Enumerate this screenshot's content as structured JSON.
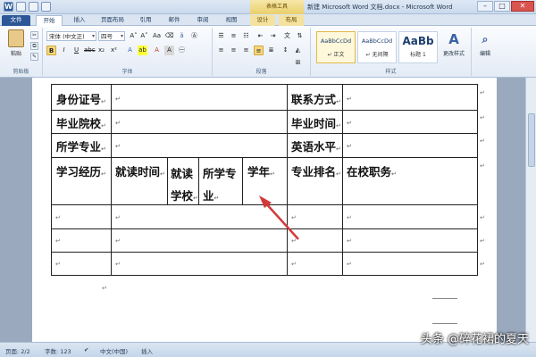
{
  "window": {
    "title": "新建 Microsoft Word 文档.docx - Microsoft Word",
    "context_tab_group": "表格工具"
  },
  "tabs": [
    {
      "label": "文件"
    },
    {
      "label": "开始"
    },
    {
      "label": "插入"
    },
    {
      "label": "页面布局"
    },
    {
      "label": "引用"
    },
    {
      "label": "邮件"
    },
    {
      "label": "审阅"
    },
    {
      "label": "视图"
    },
    {
      "label": "设计"
    },
    {
      "label": "布局"
    }
  ],
  "ribbon": {
    "clipboard": {
      "paste_label": "粘贴",
      "group_label": "剪贴板"
    },
    "font": {
      "font_name": "宋体 (中文正)",
      "font_size": "四号",
      "group_label": "字体"
    },
    "paragraph": {
      "group_label": "段落"
    },
    "styles": {
      "group_label": "样式",
      "items": [
        {
          "sample": "AaBbCcDd",
          "name": "↵ 正文"
        },
        {
          "sample": "AaBbCcDd",
          "name": "↵ 无间隔"
        },
        {
          "sample": "AaBb",
          "name": "标题 1"
        }
      ],
      "change_styles": "更改样式"
    },
    "editing": {
      "label": "编辑"
    }
  },
  "table": {
    "rows": [
      {
        "cells": [
          "身份证号",
          "",
          "联系方式",
          ""
        ]
      },
      {
        "cells": [
          "毕业院校",
          "",
          "毕业时间",
          ""
        ]
      },
      {
        "cells": [
          "所学专业",
          "",
          "英语水平",
          ""
        ]
      },
      {
        "cells": [
          "学习经历",
          "就读时间",
          "就读学校",
          "所学专业",
          "学年",
          "专业排名",
          "在校职务"
        ]
      }
    ]
  },
  "statusbar": {
    "page": "页面: 2/2",
    "words": "字数: 123",
    "language": "中文(中国)",
    "mode": "插入"
  },
  "watermark": "头条 @碎花裙的夏天",
  "colors": {
    "accent": "#2b5797",
    "arrow": "#d33a3a"
  }
}
